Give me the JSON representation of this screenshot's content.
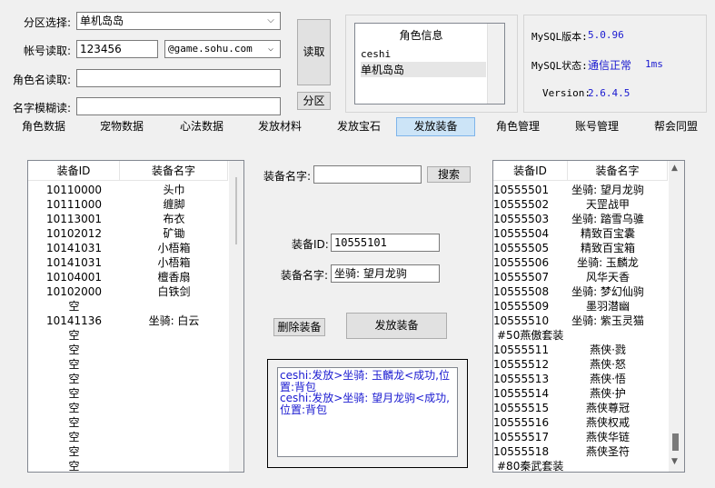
{
  "form": {
    "zone_label": "分区选择:",
    "zone_value": "单机岛岛",
    "account_label": "帐号读取:",
    "account_value": "123456",
    "domain_value": "@game.sohu.com",
    "role_label": "角色名读取:",
    "role_value": "",
    "fuzzy_label": "名字模糊读:",
    "fuzzy_value": "",
    "read_button": "读取",
    "zone_button": "分区"
  },
  "role_info": {
    "title": "角色信息",
    "items": [
      "ceshi",
      "单机岛岛"
    ]
  },
  "mysql": {
    "version_label": "MySQL版本:",
    "version_value": "5.0.96",
    "status_label": "MySQL状态:",
    "status_value": "通信正常",
    "latency": "1ms",
    "app_version_label": "Version:",
    "app_version_value": "2.6.4.5",
    "value_color": "#1a1ad0"
  },
  "tabs": [
    "角色数据",
    "宠物数据",
    "心法数据",
    "发放材料",
    "发放宝石",
    "发放装备",
    "角色管理",
    "账号管理",
    "帮会同盟"
  ],
  "active_tab": "发放装备",
  "left_list": {
    "col1": "装备ID",
    "col2": "装备名字",
    "rows": [
      [
        "10110000",
        "头巾"
      ],
      [
        "10111000",
        "缠脚"
      ],
      [
        "10113001",
        "布衣"
      ],
      [
        "10102012",
        "矿锄"
      ],
      [
        "10141031",
        "小梧箱"
      ],
      [
        "10141031",
        "小梧箱"
      ],
      [
        "10104001",
        "檀香扇"
      ],
      [
        "10102000",
        "白铁剑"
      ],
      [
        "空",
        ""
      ],
      [
        "10141136",
        "坐骑: 白云"
      ],
      [
        "空",
        ""
      ],
      [
        "空",
        ""
      ],
      [
        "空",
        ""
      ],
      [
        "空",
        ""
      ],
      [
        "空",
        ""
      ],
      [
        "空",
        ""
      ],
      [
        "空",
        ""
      ],
      [
        "空",
        ""
      ],
      [
        "空",
        ""
      ],
      [
        "空",
        ""
      ]
    ]
  },
  "middle": {
    "search_label": "装备名字:",
    "search_value": "",
    "search_button": "搜索",
    "equip_id_label": "装备ID:",
    "equip_id_value": "10555101",
    "equip_name_label": "装备名字:",
    "equip_name_value": "坐骑: 望月龙驹",
    "delete_button": "删除装备",
    "issue_button": "发放装备",
    "log_lines": [
      "ceshi:发放>坐骑: 玉麟龙<成功,位置:背包",
      "ceshi:发放>坐骑: 望月龙驹<成功,位置:背包"
    ]
  },
  "right_list": {
    "col1": "装备ID",
    "col2": "装备名字",
    "rows": [
      [
        "10555501",
        "坐骑: 望月龙驹"
      ],
      [
        "10555502",
        "天罡战甲"
      ],
      [
        "10555503",
        "坐骑: 踏雪乌骓"
      ],
      [
        "10555504",
        "精致百宝囊"
      ],
      [
        "10555505",
        "精致百宝箱"
      ],
      [
        "10555506",
        "坐骑: 玉麟龙"
      ],
      [
        "10555507",
        "风华天香"
      ],
      [
        "10555508",
        "坐骑: 梦幻仙驹"
      ],
      [
        "10555509",
        "墨羽潜幽"
      ],
      [
        "10555510",
        "坐骑: 紫玉灵猫"
      ],
      [
        "#50燕傲套装",
        ""
      ],
      [
        "10555511",
        "燕侠·戮"
      ],
      [
        "10555512",
        "燕侠·怒"
      ],
      [
        "10555513",
        "燕侠·悟"
      ],
      [
        "10555514",
        "燕侠·护"
      ],
      [
        "10555515",
        "燕侠尊冠"
      ],
      [
        "10555516",
        "燕侠权戒"
      ],
      [
        "10555517",
        "燕侠华链"
      ],
      [
        "10555518",
        "燕侠圣符"
      ],
      [
        "#80秦武套装",
        ""
      ]
    ]
  }
}
